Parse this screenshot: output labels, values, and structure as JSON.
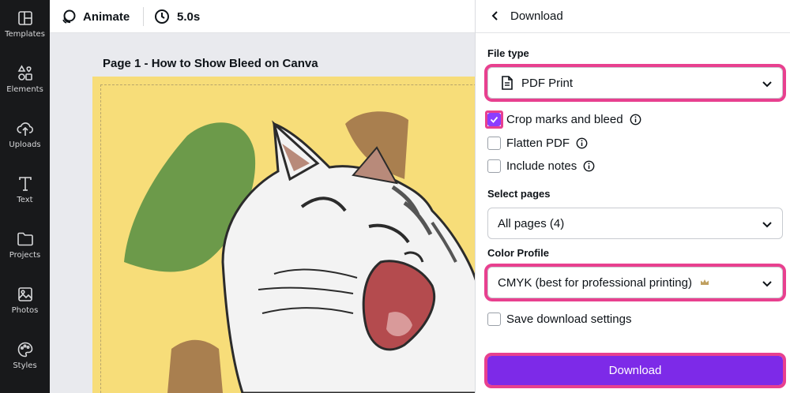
{
  "sidebar": {
    "items": [
      {
        "label": "Templates",
        "icon": "templates-icon"
      },
      {
        "label": "Elements",
        "icon": "elements-icon"
      },
      {
        "label": "Uploads",
        "icon": "uploads-icon"
      },
      {
        "label": "Text",
        "icon": "text-icon"
      },
      {
        "label": "Projects",
        "icon": "projects-icon"
      },
      {
        "label": "Photos",
        "icon": "photos-icon"
      },
      {
        "label": "Styles",
        "icon": "styles-icon"
      }
    ]
  },
  "toolbar": {
    "animate_label": "Animate",
    "duration_label": "5.0s"
  },
  "canvas": {
    "page_title": "Page 1 - How to Show Bleed on Canva"
  },
  "download_panel": {
    "title": "Download",
    "file_type_label": "File type",
    "file_type_value": "PDF Print",
    "options": {
      "crop_marks": {
        "label": "Crop marks and bleed",
        "checked": true
      },
      "flatten_pdf": {
        "label": "Flatten PDF",
        "checked": false
      },
      "include_notes": {
        "label": "Include notes",
        "checked": false
      }
    },
    "select_pages_label": "Select pages",
    "select_pages_value": "All pages (4)",
    "color_profile_label": "Color Profile",
    "color_profile_value": "CMYK (best for professional printing)",
    "save_settings": {
      "label": "Save download settings",
      "checked": false
    },
    "download_button": "Download"
  },
  "colors": {
    "sidebar_bg": "#18191b",
    "accent_purple": "#7d2ae8",
    "highlight_pink": "#e8408f",
    "design_yellow": "#f7dd79"
  }
}
